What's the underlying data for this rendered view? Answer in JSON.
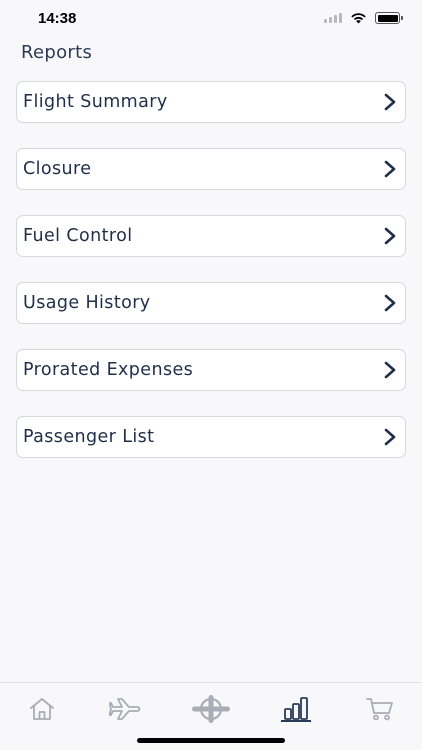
{
  "status_bar": {
    "time": "14:38"
  },
  "page": {
    "title": "Reports"
  },
  "reports": [
    {
      "label": "Flight Summary"
    },
    {
      "label": "Closure"
    },
    {
      "label": "Fuel Control"
    },
    {
      "label": "Usage History"
    },
    {
      "label": "Prorated Expenses"
    },
    {
      "label": "Passenger List"
    }
  ],
  "tab_bar": {
    "tabs": [
      {
        "icon": "home-icon",
        "active": false
      },
      {
        "icon": "airplane-icon",
        "active": false
      },
      {
        "icon": "propeller-icon",
        "active": false
      },
      {
        "icon": "bar-chart-icon",
        "active": true
      },
      {
        "icon": "cart-icon",
        "active": false
      }
    ],
    "active_color": "#2b3a58",
    "inactive_color": "#a9adb6"
  }
}
